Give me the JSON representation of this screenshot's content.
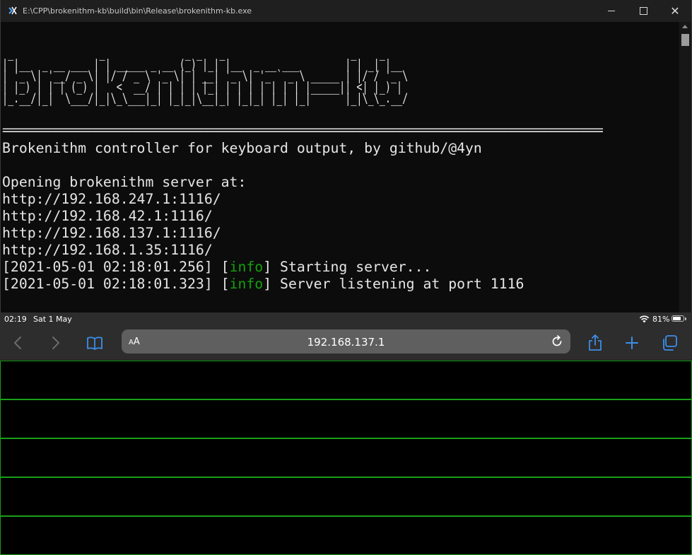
{
  "window": {
    "title": "E:\\CPP\\brokenithm-kb\\build\\bin\\Release\\brokenithm-kb.exe"
  },
  "console": {
    "banner_art": " _               _              _ _   _                      _    _\n| |__  _ __ ___ | | _____ _ __ (_) |_| |__  _ __ ___        | | _| |__\n| '_ \\| '__/ _ \\| |/ / _ \\ '_ \\| | __| '_ \\| '_ ` _ \\ _____ | |/ / '_ \\\n| |_) | | | (_) |   <  __/ | | | | |_| | | | | | | | |_____|| <| |_) |\n|_.__/|_|  \\___/|_|\\_\\___|_| |_|_|\\__|_| |_|_| |_| |_|      |_|\\_\\_.__/",
    "separator": "==================================================================================================",
    "lines": [
      "Brokenithm controller for keyboard output, by github/@4yn",
      "Opening brokenithm server at:",
      "http://192.168.247.1:1116/",
      "http://192.168.42.1:1116/",
      "http://192.168.137.1:1116/",
      "http://192.168.1.35:1116/"
    ],
    "log": [
      {
        "time": "[2021-05-01 02:18:01.256]",
        "open": " [",
        "level": "info",
        "close": "] ",
        "message": "Starting server..."
      },
      {
        "time": "[2021-05-01 02:18:01.323]",
        "open": " [",
        "level": "info",
        "close": "] ",
        "message": "Server listening at port 1116"
      }
    ]
  },
  "ipad": {
    "status": {
      "time": "02:19",
      "date": "Sat 1 May",
      "battery": "81%",
      "battery_level": 0.81
    },
    "safari": {
      "text_size_small": "A",
      "text_size_large": "A",
      "url": "192.168.137.1"
    },
    "rows": [
      "",
      "",
      "",
      "",
      ""
    ]
  },
  "colors": {
    "info": "#13a10e",
    "touch_border": "#18a018"
  }
}
